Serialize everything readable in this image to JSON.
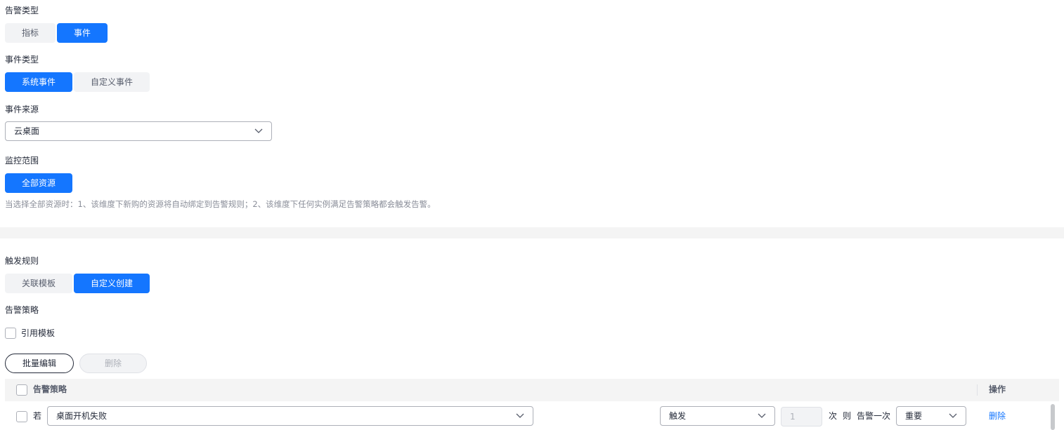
{
  "alarm_type": {
    "label": "告警类型",
    "options": [
      "指标",
      "事件"
    ],
    "selected": "事件"
  },
  "event_type": {
    "label": "事件类型",
    "options": [
      "系统事件",
      "自定义事件"
    ],
    "selected": "系统事件"
  },
  "event_source": {
    "label": "事件来源",
    "value": "云桌面"
  },
  "monitor_scope": {
    "label": "监控范围",
    "button": "全部资源",
    "hint": "当选择全部资源时：1、该维度下新购的资源将自动绑定到告警规则；2、该维度下任何实例满足告警策略都会触发告警。"
  },
  "trigger_rule": {
    "label": "触发规则",
    "options": [
      "关联模板",
      "自定义创建"
    ],
    "selected": "自定义创建"
  },
  "alarm_policy": {
    "label": "告警策略",
    "use_template_label": "引用模板",
    "batch_edit": "批量编辑",
    "delete": "删除"
  },
  "table": {
    "col_policy": "告警策略",
    "col_actions": "操作",
    "rows": [
      {
        "if_label": "若",
        "event": "桌面开机失败",
        "trigger": "触发",
        "count": "1",
        "times_label": "次",
        "then_label": "则",
        "alarm_once": "告警一次",
        "severity": "重要",
        "delete": "删除"
      }
    ]
  },
  "colors": {
    "primary": "#1476ff",
    "segment_off_bg": "#f2f3f5"
  }
}
